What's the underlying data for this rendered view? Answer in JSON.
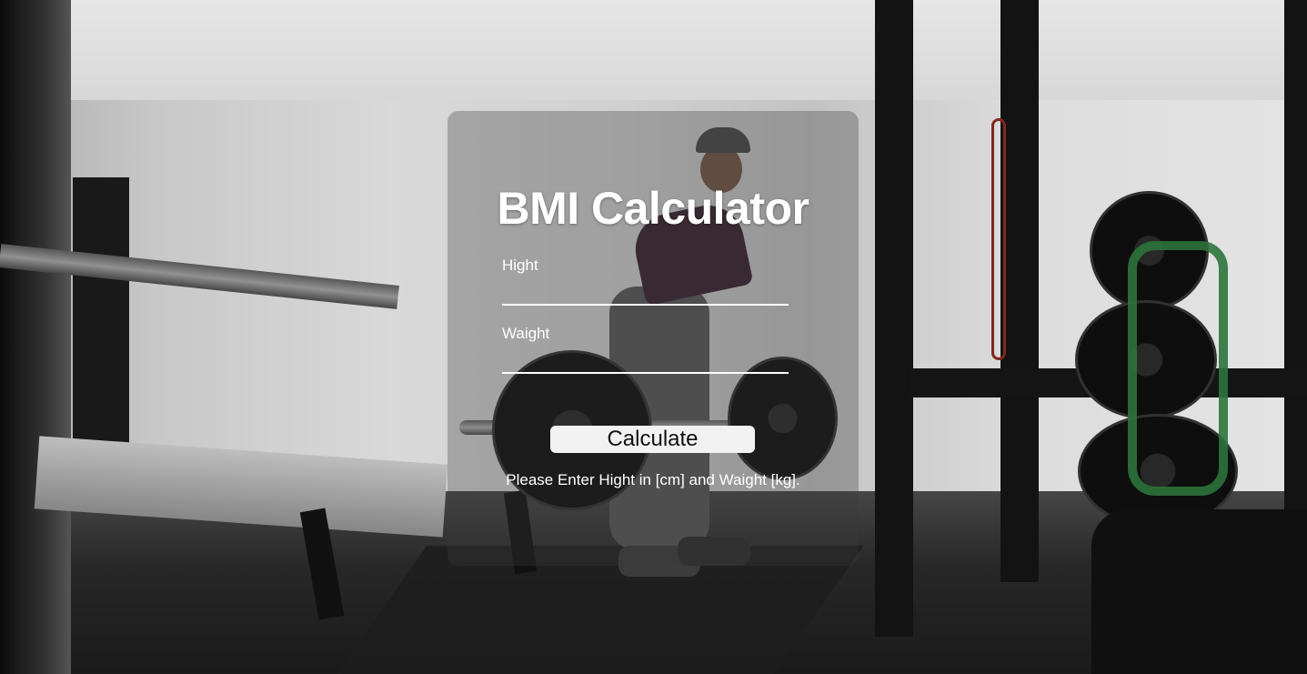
{
  "app": {
    "title": "BMI Calculator"
  },
  "form": {
    "height_label": "Hight",
    "height_value": "",
    "weight_label": "Waight",
    "weight_value": "",
    "calculate_label": "Calculate",
    "message": "Please Enter Hight in [cm] and Waight [kg]."
  },
  "colors": {
    "card_overlay": "#3c3c3c",
    "text": "#ffffff",
    "button_bg": "#f2f2f2",
    "button_text": "#111111"
  },
  "background": {
    "image_subject": "gym-deadlift-photo"
  }
}
